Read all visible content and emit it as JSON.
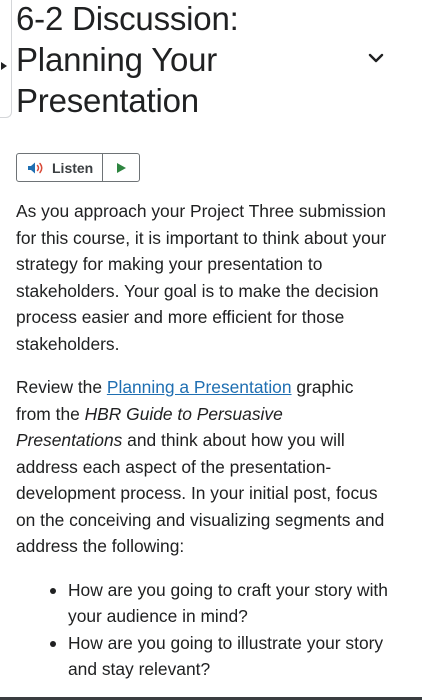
{
  "title": "6-2 Discussion: Planning Your Presentation",
  "listen": {
    "label": "Listen",
    "speaker_icon": "speaker-icon",
    "play_icon": "play-icon"
  },
  "paragraph1": "As you approach your Project Three submission for this course, it is important to think about your strategy for making your presentation to stakeholders. Your goal is to make the decision process easier and more efficient for those stakeholders.",
  "paragraph2": {
    "prefix": "Review the ",
    "link": "Planning a Presentation",
    "mid": " graphic from the ",
    "italic": "HBR Guide to Persuasive Presentations",
    "suffix": " and think about how you will address each aspect of the presentation-development process. In your initial post, focus on the conceiving and visualizing segments and address the following:"
  },
  "bullets": [
    "How are you going to craft your story with your audience in mind?",
    "How are you going to illustrate your story and stay relevant?"
  ],
  "colors": {
    "link": "#1f6fb2",
    "speaker_blue": "#1f6fb2",
    "speaker_red": "#d94a38",
    "play_green": "#2e8540"
  }
}
